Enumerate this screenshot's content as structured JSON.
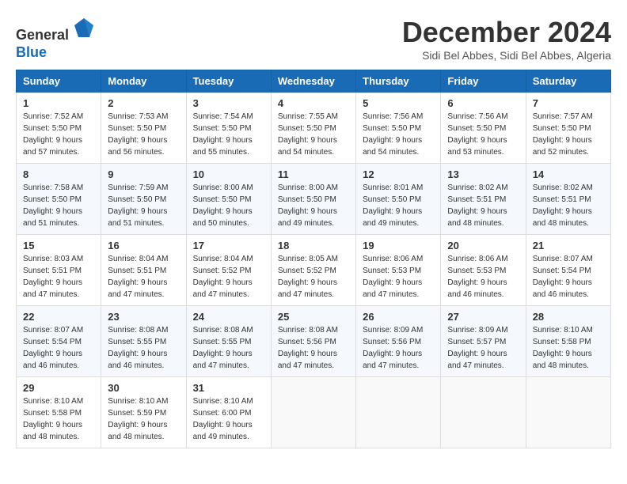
{
  "header": {
    "logo_line1": "General",
    "logo_line2": "Blue",
    "month": "December 2024",
    "location": "Sidi Bel Abbes, Sidi Bel Abbes, Algeria"
  },
  "days_of_week": [
    "Sunday",
    "Monday",
    "Tuesday",
    "Wednesday",
    "Thursday",
    "Friday",
    "Saturday"
  ],
  "weeks": [
    [
      {
        "day": 1,
        "sunrise": "7:52 AM",
        "sunset": "5:50 PM",
        "daylight": "9 hours and 57 minutes."
      },
      {
        "day": 2,
        "sunrise": "7:53 AM",
        "sunset": "5:50 PM",
        "daylight": "9 hours and 56 minutes."
      },
      {
        "day": 3,
        "sunrise": "7:54 AM",
        "sunset": "5:50 PM",
        "daylight": "9 hours and 55 minutes."
      },
      {
        "day": 4,
        "sunrise": "7:55 AM",
        "sunset": "5:50 PM",
        "daylight": "9 hours and 54 minutes."
      },
      {
        "day": 5,
        "sunrise": "7:56 AM",
        "sunset": "5:50 PM",
        "daylight": "9 hours and 54 minutes."
      },
      {
        "day": 6,
        "sunrise": "7:56 AM",
        "sunset": "5:50 PM",
        "daylight": "9 hours and 53 minutes."
      },
      {
        "day": 7,
        "sunrise": "7:57 AM",
        "sunset": "5:50 PM",
        "daylight": "9 hours and 52 minutes."
      }
    ],
    [
      {
        "day": 8,
        "sunrise": "7:58 AM",
        "sunset": "5:50 PM",
        "daylight": "9 hours and 51 minutes."
      },
      {
        "day": 9,
        "sunrise": "7:59 AM",
        "sunset": "5:50 PM",
        "daylight": "9 hours and 51 minutes."
      },
      {
        "day": 10,
        "sunrise": "8:00 AM",
        "sunset": "5:50 PM",
        "daylight": "9 hours and 50 minutes."
      },
      {
        "day": 11,
        "sunrise": "8:00 AM",
        "sunset": "5:50 PM",
        "daylight": "9 hours and 49 minutes."
      },
      {
        "day": 12,
        "sunrise": "8:01 AM",
        "sunset": "5:50 PM",
        "daylight": "9 hours and 49 minutes."
      },
      {
        "day": 13,
        "sunrise": "8:02 AM",
        "sunset": "5:51 PM",
        "daylight": "9 hours and 48 minutes."
      },
      {
        "day": 14,
        "sunrise": "8:02 AM",
        "sunset": "5:51 PM",
        "daylight": "9 hours and 48 minutes."
      }
    ],
    [
      {
        "day": 15,
        "sunrise": "8:03 AM",
        "sunset": "5:51 PM",
        "daylight": "9 hours and 47 minutes."
      },
      {
        "day": 16,
        "sunrise": "8:04 AM",
        "sunset": "5:51 PM",
        "daylight": "9 hours and 47 minutes."
      },
      {
        "day": 17,
        "sunrise": "8:04 AM",
        "sunset": "5:52 PM",
        "daylight": "9 hours and 47 minutes."
      },
      {
        "day": 18,
        "sunrise": "8:05 AM",
        "sunset": "5:52 PM",
        "daylight": "9 hours and 47 minutes."
      },
      {
        "day": 19,
        "sunrise": "8:06 AM",
        "sunset": "5:53 PM",
        "daylight": "9 hours and 47 minutes."
      },
      {
        "day": 20,
        "sunrise": "8:06 AM",
        "sunset": "5:53 PM",
        "daylight": "9 hours and 46 minutes."
      },
      {
        "day": 21,
        "sunrise": "8:07 AM",
        "sunset": "5:54 PM",
        "daylight": "9 hours and 46 minutes."
      }
    ],
    [
      {
        "day": 22,
        "sunrise": "8:07 AM",
        "sunset": "5:54 PM",
        "daylight": "9 hours and 46 minutes."
      },
      {
        "day": 23,
        "sunrise": "8:08 AM",
        "sunset": "5:55 PM",
        "daylight": "9 hours and 46 minutes."
      },
      {
        "day": 24,
        "sunrise": "8:08 AM",
        "sunset": "5:55 PM",
        "daylight": "9 hours and 47 minutes."
      },
      {
        "day": 25,
        "sunrise": "8:08 AM",
        "sunset": "5:56 PM",
        "daylight": "9 hours and 47 minutes."
      },
      {
        "day": 26,
        "sunrise": "8:09 AM",
        "sunset": "5:56 PM",
        "daylight": "9 hours and 47 minutes."
      },
      {
        "day": 27,
        "sunrise": "8:09 AM",
        "sunset": "5:57 PM",
        "daylight": "9 hours and 47 minutes."
      },
      {
        "day": 28,
        "sunrise": "8:10 AM",
        "sunset": "5:58 PM",
        "daylight": "9 hours and 48 minutes."
      }
    ],
    [
      {
        "day": 29,
        "sunrise": "8:10 AM",
        "sunset": "5:58 PM",
        "daylight": "9 hours and 48 minutes."
      },
      {
        "day": 30,
        "sunrise": "8:10 AM",
        "sunset": "5:59 PM",
        "daylight": "9 hours and 48 minutes."
      },
      {
        "day": 31,
        "sunrise": "8:10 AM",
        "sunset": "6:00 PM",
        "daylight": "9 hours and 49 minutes."
      },
      null,
      null,
      null,
      null
    ]
  ]
}
